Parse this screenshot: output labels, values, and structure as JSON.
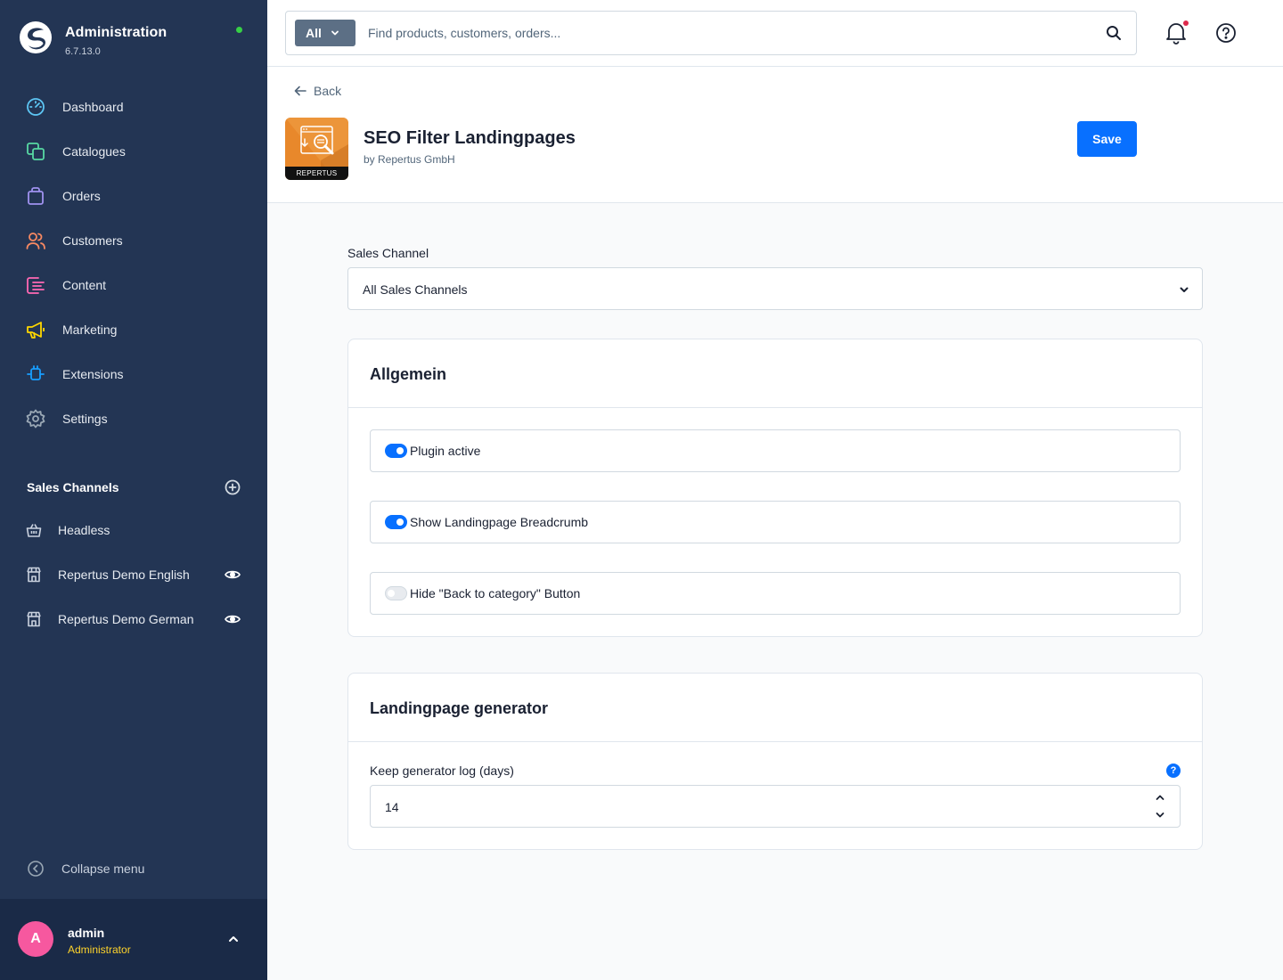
{
  "brand": {
    "title": "Administration",
    "version": "6.7.13.0"
  },
  "nav": [
    {
      "label": "Dashboard",
      "icon": "dashboard-icon",
      "color": "#5dc6f4"
    },
    {
      "label": "Catalogues",
      "icon": "catalogues-icon",
      "color": "#57d9a3"
    },
    {
      "label": "Orders",
      "icon": "orders-icon",
      "color": "#a092f0"
    },
    {
      "label": "Customers",
      "icon": "customers-icon",
      "color": "#f88962"
    },
    {
      "label": "Content",
      "icon": "content-icon",
      "color": "#ff68b4"
    },
    {
      "label": "Marketing",
      "icon": "marketing-icon",
      "color": "#ffd700"
    },
    {
      "label": "Extensions",
      "icon": "extensions-icon",
      "color": "#189eff"
    },
    {
      "label": "Settings",
      "icon": "settings-icon",
      "color": "#9aa8b5"
    }
  ],
  "sales_channels": {
    "title": "Sales Channels",
    "items": [
      {
        "label": "Headless"
      },
      {
        "label": "Repertus Demo English"
      },
      {
        "label": "Repertus Demo German"
      }
    ]
  },
  "collapse_label": "Collapse menu",
  "user": {
    "initial": "A",
    "name": "admin",
    "role": "Administrator"
  },
  "search": {
    "type_label": "All",
    "placeholder": "Find products, customers, orders..."
  },
  "header": {
    "back_label": "Back",
    "plugin_title": "SEO Filter Landingpages",
    "plugin_author": "by Repertus GmbH",
    "plugin_badge": "REPERTUS",
    "save_label": "Save"
  },
  "sales_channel_select": {
    "label": "Sales Channel",
    "value": "All Sales Channels"
  },
  "general_card": {
    "title": "Allgemein",
    "settings": [
      {
        "label": "Plugin active",
        "enabled": true
      },
      {
        "label": "Show Landingpage Breadcrumb",
        "enabled": true
      },
      {
        "label": "Hide \"Back to category\" Button",
        "enabled": false
      }
    ]
  },
  "generator_card": {
    "title": "Landingpage generator",
    "field_label": "Keep generator log (days)",
    "help_badge": "?",
    "value": "14"
  }
}
